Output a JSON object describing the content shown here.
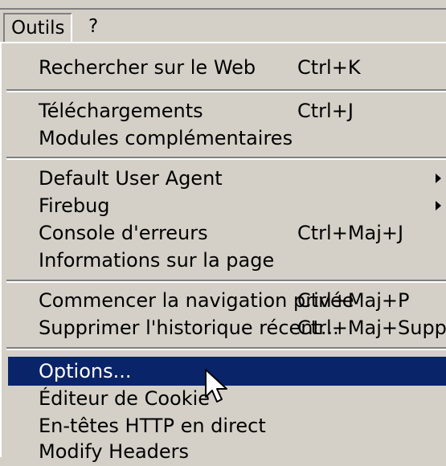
{
  "menubar": {
    "items": [
      {
        "label": "Outils",
        "mnemonic": "O"
      },
      {
        "label": "?",
        "mnemonic": "?"
      }
    ]
  },
  "menu": {
    "groups": [
      [
        {
          "label": "Rechercher sur le Web",
          "shortcut": "Ctrl+K"
        }
      ],
      [
        {
          "label": "Téléchargements",
          "shortcut": "Ctrl+J"
        },
        {
          "label": "Modules complémentaires",
          "shortcut": ""
        }
      ],
      [
        {
          "label": "Default User Agent",
          "shortcut": "",
          "submenu": true
        },
        {
          "label": "Firebug",
          "shortcut": "",
          "submenu": true
        },
        {
          "label": "Console d'erreurs",
          "shortcut": "Ctrl+Maj+J"
        },
        {
          "label": "Informations sur la page",
          "shortcut": ""
        }
      ],
      [
        {
          "label": "Commencer la navigation privée",
          "shortcut": "Ctrl+Maj+P"
        },
        {
          "label": "Supprimer l'historique récent...",
          "shortcut": "Ctrl+Maj+Suppr"
        }
      ],
      [
        {
          "label": "Options...",
          "shortcut": "",
          "highlighted": true
        },
        {
          "label": "Éditeur de Cookie",
          "shortcut": ""
        },
        {
          "label": "En-têtes HTTP en direct",
          "shortcut": ""
        },
        {
          "label": "Modify Headers",
          "shortcut": ""
        }
      ]
    ]
  },
  "colors": {
    "menu_bg": "#d4d0c8",
    "highlight_bg": "#0a246a",
    "highlight_fg": "#ffffff"
  },
  "icons": {
    "submenu": "submenu-arrow-icon",
    "cursor": "mouse-pointer-icon"
  }
}
